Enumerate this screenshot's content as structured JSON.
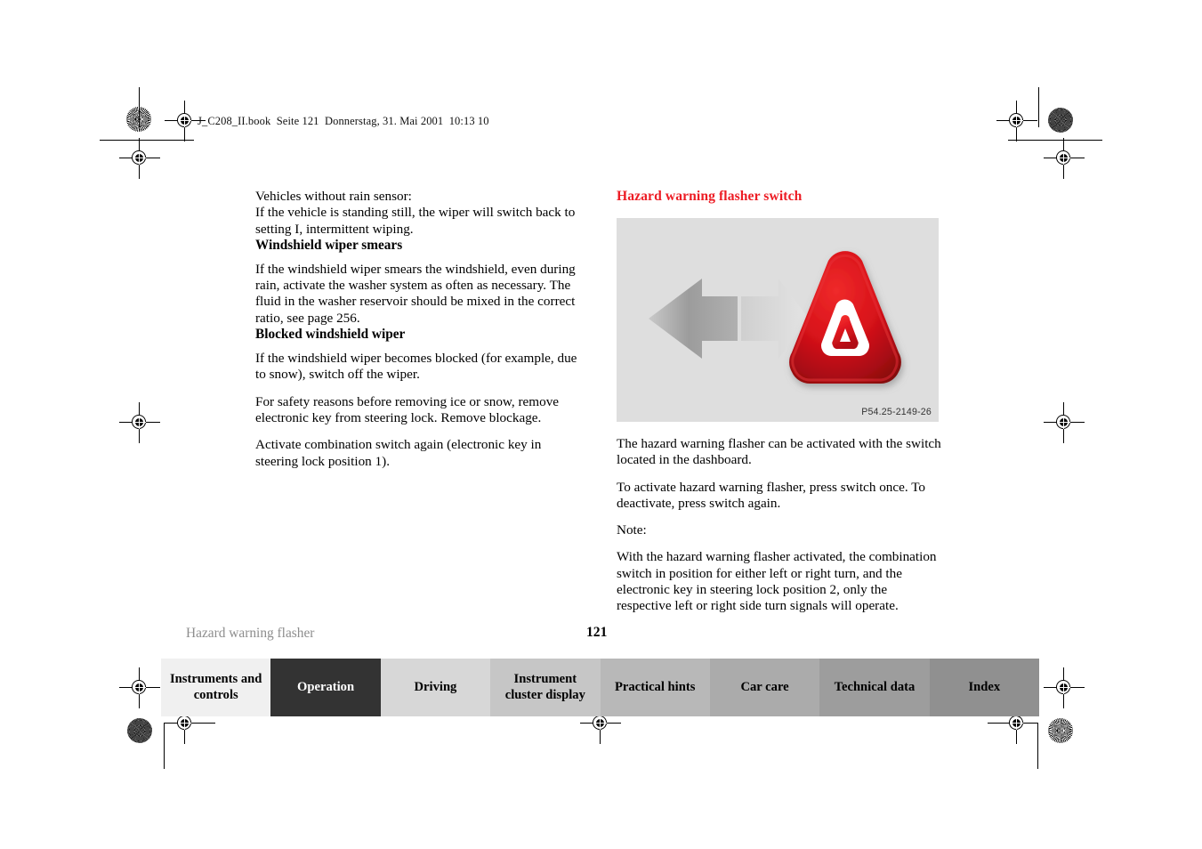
{
  "document": {
    "file_header": "J_C208_II.book  Seite 121  Donnerstag, 31. Mai 2001  10:13 10",
    "running_head": "Hazard warning flasher",
    "page_number": "121"
  },
  "left_column": {
    "intro_line1": "Vehicles without rain sensor:",
    "intro_line2": "If the vehicle is standing still, the wiper will switch back to setting I, intermittent wiping.",
    "heading_smears": "Windshield wiper smears",
    "smears_body": "If the windshield wiper smears the windshield, even during rain, activate the washer system as often as necessary. The fluid in the washer reservoir should be mixed in the correct ratio, see page 256.",
    "heading_blocked": "Blocked windshield wiper",
    "blocked_p1": "If the windshield wiper becomes blocked (for example, due to snow), switch off the wiper.",
    "blocked_p2": "For safety reasons before removing ice or snow, remove electronic key from steering lock. Remove blockage.",
    "blocked_p3": "Activate combination switch again (electronic key in steering lock position 1)."
  },
  "right_column": {
    "heading": "Hazard warning flasher switch",
    "heading_color": "#ED1C24",
    "figure": {
      "caption": "P54.25-2149-26",
      "background_color": "#dedede",
      "elements": [
        "left-arrow-grey",
        "right-arrow-light-grey",
        "hazard-warning-triangle-button-red"
      ]
    },
    "p1": "The hazard warning flasher can be activated with the switch located in the dashboard.",
    "p2": "To activate hazard warning flasher, press switch once. To deactivate, press switch again.",
    "note_label": "Note:",
    "note_body": "With the hazard warning flasher activated, the combination switch in position for either left or right turn, and the electronic key in steering lock position 2, only the respective left or right side turn signals will operate."
  },
  "tabbar": {
    "tabs": [
      {
        "label": "Instruments and controls",
        "bg": "#f0f0f0",
        "active": false
      },
      {
        "label": "Operation",
        "bg": "#333333",
        "active": true
      },
      {
        "label": "Driving",
        "bg": "#d7d7d7",
        "active": false
      },
      {
        "label": "Instrument cluster display",
        "bg": "#c6c6c6",
        "active": false
      },
      {
        "label": "Practical hints",
        "bg": "#b8b8b8",
        "active": false
      },
      {
        "label": "Car care",
        "bg": "#ababab",
        "active": false
      },
      {
        "label": "Technical data",
        "bg": "#9d9d9d",
        "active": false
      },
      {
        "label": "Index",
        "bg": "#909090",
        "active": false
      }
    ]
  }
}
